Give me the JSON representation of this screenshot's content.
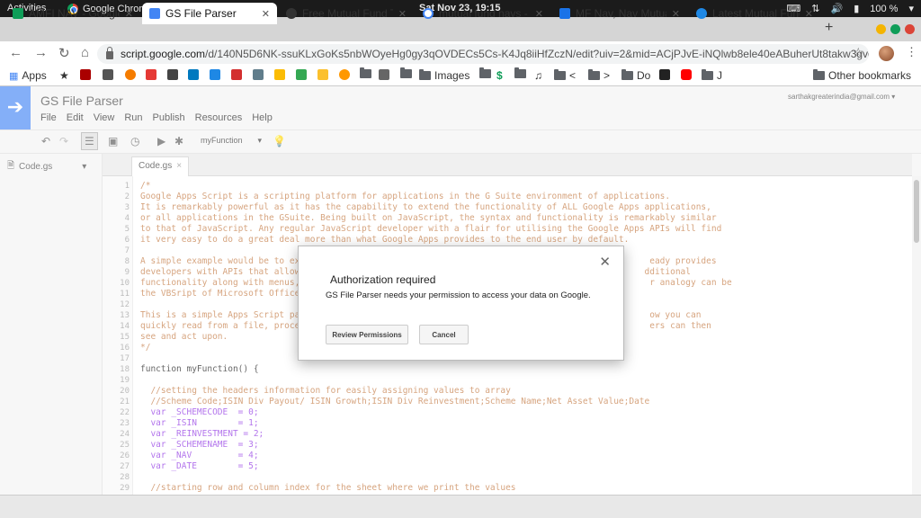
{
  "os": {
    "activities": "Activities",
    "app_name": "Google Chrome",
    "clock": "Sat Nov 23, 19:15",
    "battery": "100 %"
  },
  "tabs": [
    {
      "label": "AMFI NAV - Google S",
      "favicon_color": "#0f9d58"
    },
    {
      "label": "GS File Parser",
      "favicon_color": "#4285f4",
      "active": true
    },
    {
      "label": "Free Mutual Fund Ti",
      "favicon_color": "#333333"
    },
    {
      "label": "mutual fund navs - (",
      "favicon_color": "#4285f4"
    },
    {
      "label": "MF Nav, Nav Mutual",
      "favicon_color": "#1a73e8"
    },
    {
      "label": "Latest Mutual Fund",
      "favicon_color": "#1e88e5"
    }
  ],
  "address": {
    "host": "script.google.com",
    "path": "/d/140N5D6NK-ssuKLxGoKs5nbWOyeHg0gy3qOVDECs5Cs-K4Jq8iiHfZczN/edit?uiv=2&mid=ACjPJvE-iNQlwb8ele40eABuherUt8takw3gvdMibGnj8…"
  },
  "bookmarks": {
    "apps": "Apps",
    "images": "Images",
    "lt": "<",
    "gt": ">",
    "do": "Do",
    "j": "J",
    "other": "Other bookmarks"
  },
  "script": {
    "title": "GS File Parser",
    "menu": [
      "File",
      "Edit",
      "View",
      "Run",
      "Publish",
      "Resources",
      "Help"
    ],
    "user": "sarthakgreaterindia@gmail.com",
    "function_select": "myFunction",
    "file": "Code.gs"
  },
  "code_lines": [
    {
      "n": "1",
      "t": "/*",
      "c": "cm"
    },
    {
      "n": "2",
      "t": "Google Apps Script is a scripting platform for applications in the G Suite environment of applications.",
      "c": "cm"
    },
    {
      "n": "3",
      "t": "It is remarkably powerful as it has the capability to extend the functionality of ALL Google Apps applications,",
      "c": "cm"
    },
    {
      "n": "4",
      "t": "or all applications in the GSuite. Being built on JavaScript, the syntax and functionality is remarkably similar",
      "c": "cm"
    },
    {
      "n": "5",
      "t": "to that of JavaScript. Any regular JavaScript developer with a flair for utilising the Google Apps APIs will find",
      "c": "cm"
    },
    {
      "n": "6",
      "t": "it very easy to do a great deal more than what Google Apps provides to the end user by default.",
      "c": "cm"
    },
    {
      "n": "7",
      "t": "",
      "c": "cm"
    },
    {
      "n": "8",
      "t": "A simple example would be to exte                                                                  eady provides",
      "c": "cm"
    },
    {
      "n": "9",
      "t": "developers with APIs that allows                                                                  dditional",
      "c": "cm"
    },
    {
      "n": "10",
      "t": "functionality along with menus, t                                                                  r analogy can be",
      "c": "cm"
    },
    {
      "n": "11",
      "t": "the VBSript of Microsoft Office A",
      "c": "cm"
    },
    {
      "n": "12",
      "t": "",
      "c": "cm"
    },
    {
      "n": "13",
      "t": "This is a simple Apps Script pars                                                                  ow you can",
      "c": "cm"
    },
    {
      "n": "14",
      "t": "quickly read from a file, process                                                                  ers can then",
      "c": "cm"
    },
    {
      "n": "15",
      "t": "see and act upon.",
      "c": "cm"
    },
    {
      "n": "16",
      "t": "*/",
      "c": "cm"
    },
    {
      "n": "17",
      "t": "",
      "c": "pl"
    },
    {
      "n": "18",
      "t": "function myFunction() {",
      "c": "fn"
    },
    {
      "n": "19",
      "t": "",
      "c": "pl"
    },
    {
      "n": "20",
      "t": "  //setting the headers information for easily assigning values to array",
      "c": "cm"
    },
    {
      "n": "21",
      "t": "  //Scheme Code;ISIN Div Payout/ ISIN Growth;ISIN Div Reinvestment;Scheme Name;Net Asset Value;Date",
      "c": "cm"
    },
    {
      "n": "22",
      "t": "  var _SCHEMECODE  = 0;",
      "c": "vr"
    },
    {
      "n": "23",
      "t": "  var _ISIN        = 1;",
      "c": "vr"
    },
    {
      "n": "24",
      "t": "  var _REINVESTMENT = 2;",
      "c": "vr"
    },
    {
      "n": "25",
      "t": "  var _SCHEMENAME  = 3;",
      "c": "vr"
    },
    {
      "n": "26",
      "t": "  var _NAV         = 4;",
      "c": "vr"
    },
    {
      "n": "27",
      "t": "  var _DATE        = 5;",
      "c": "vr"
    },
    {
      "n": "28",
      "t": "",
      "c": "pl"
    },
    {
      "n": "29",
      "t": "  //starting row and column index for the sheet where we print the values",
      "c": "cm"
    }
  ],
  "modal": {
    "title": "Authorization required",
    "body": "GS File Parser needs your permission to access your data on Google.",
    "review_label": "Review Permissions",
    "cancel_label": "Cancel"
  }
}
